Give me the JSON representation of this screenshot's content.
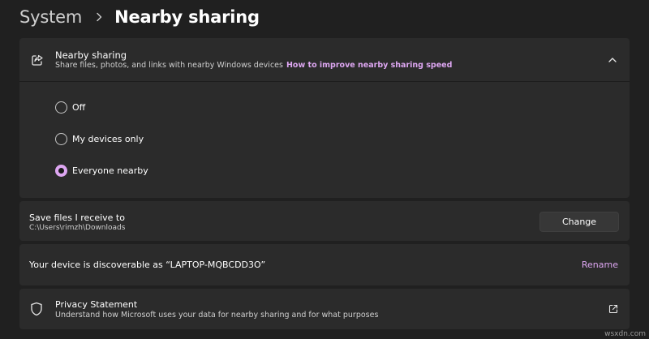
{
  "breadcrumb": {
    "parent": "System",
    "current": "Nearby sharing"
  },
  "nearby_sharing": {
    "title": "Nearby sharing",
    "description": "Share files, photos, and links with nearby Windows devices",
    "help_link": "How to improve nearby sharing speed",
    "expanded": true,
    "options": [
      {
        "label": "Off",
        "selected": false
      },
      {
        "label": "My devices only",
        "selected": false
      },
      {
        "label": "Everyone nearby",
        "selected": true
      }
    ]
  },
  "save_files": {
    "title": "Save files I receive to",
    "path": "C:\\Users\\rimzh\\Downloads",
    "button_label": "Change"
  },
  "device": {
    "text": "Your device is discoverable as “LAPTOP-MQBCDD3O”",
    "rename_label": "Rename"
  },
  "privacy": {
    "title": "Privacy Statement",
    "description": "Understand how Microsoft uses your data for nearby sharing and for what purposes"
  },
  "watermark": "wsxdn.com",
  "colors": {
    "background": "#202020",
    "card": "#2b2b2b",
    "accent": "#dda6f1"
  },
  "icons": {
    "share": "share-icon",
    "chevron": "chevron-up-icon",
    "shield": "shield-icon",
    "external": "external-link-icon",
    "separator": "chevron-right-icon"
  }
}
